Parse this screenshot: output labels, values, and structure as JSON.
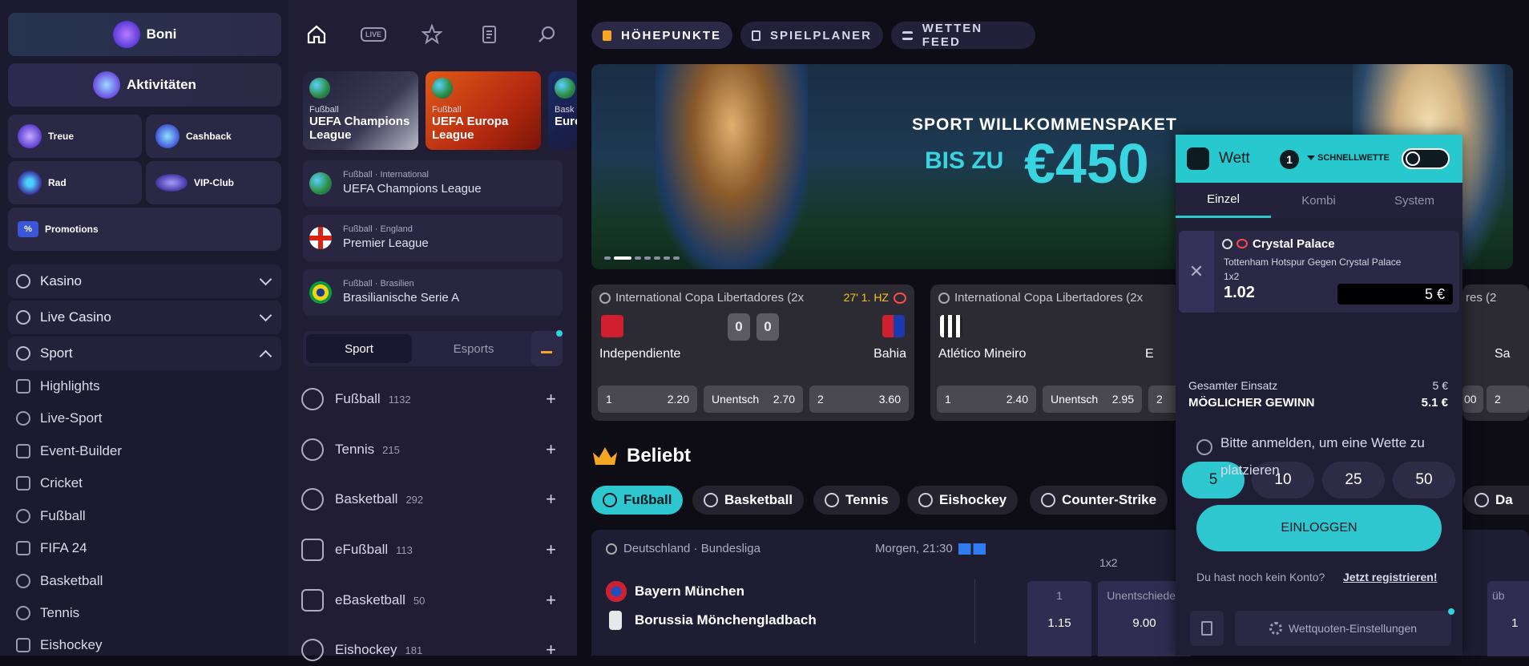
{
  "left": {
    "boni": "Boni",
    "aktivitaeten": "Aktivitäten",
    "tiles": [
      {
        "label": "Treue"
      },
      {
        "label": "Cashback"
      },
      {
        "label": "Rad"
      },
      {
        "label": "VIP-Club"
      },
      {
        "label": "Promotions"
      }
    ],
    "nav": [
      {
        "label": "Kasino"
      },
      {
        "label": "Live Casino"
      },
      {
        "label": "Sport"
      }
    ],
    "sport_items": [
      "Highlights",
      "Live-Sport",
      "Event-Builder",
      "Cricket",
      "Fußball",
      "FIFA 24",
      "Basketball",
      "Tennis",
      "Eishockey"
    ]
  },
  "mid": {
    "leagues": [
      {
        "cat": "Fußball",
        "name": "UEFA Champions League"
      },
      {
        "cat": "Fußball",
        "name": "UEFA Europa League"
      },
      {
        "cat": "Bask",
        "name": "Euro"
      }
    ],
    "rows": [
      {
        "cat": "Fußball · International",
        "name": "UEFA Champions League"
      },
      {
        "cat": "Fußball · England",
        "name": "Premier League"
      },
      {
        "cat": "Fußball · Brasilien",
        "name": "Brasilianische Serie A"
      }
    ],
    "toggle": {
      "sport": "Sport",
      "esports": "Esports"
    },
    "sports": [
      {
        "name": "Fußball",
        "count": "1132"
      },
      {
        "name": "Tennis",
        "count": "215"
      },
      {
        "name": "Basketball",
        "count": "292"
      },
      {
        "name": "eFußball",
        "count": "113"
      },
      {
        "name": "eBasketball",
        "count": "50"
      },
      {
        "name": "Eishockey",
        "count": "181"
      }
    ],
    "live_label": "LIVE"
  },
  "main": {
    "tabs": [
      "HÖHEPUNKTE",
      "SPIELPLANER",
      "WETTEN FEED"
    ],
    "banner": {
      "line1": "SPORT WILLKOMMENSPAKET",
      "line2a": "BIS ZU",
      "line2b": "€450"
    },
    "matches": [
      {
        "league": "International Copa Libertadores (2x",
        "time": "27' 1. HZ",
        "home": "Independiente",
        "away": "Bahia",
        "score_h": "0",
        "score_a": "0",
        "odds": [
          {
            "l": "1",
            "v": "2.20"
          },
          {
            "l": "Unentsch",
            "v": "2.70"
          },
          {
            "l": "2",
            "v": "3.60"
          }
        ]
      },
      {
        "league": "International Copa Libertadores (2x",
        "home": "Atlético Mineiro",
        "away": "E",
        "odds": [
          {
            "l": "1",
            "v": "2.40"
          },
          {
            "l": "Unentsch",
            "v": "2.95"
          },
          {
            "l": "2",
            "v": ""
          }
        ]
      },
      {
        "league": "res (2",
        "away": "Sa",
        "odds": [
          {
            "l": "",
            "v": "00"
          },
          {
            "l": "2",
            "v": ""
          }
        ]
      }
    ],
    "beliebt": "Beliebt",
    "cats": [
      "Fußball",
      "Basketball",
      "Tennis",
      "Eishockey",
      "Counter-Strike",
      "Da"
    ],
    "event": {
      "league": "Deutschland · Bundesliga",
      "time": "Morgen, 21:30",
      "market": "1x2",
      "home": "Bayern München",
      "away": "Borussia Mönchengladbach",
      "odds": [
        {
          "l": "1",
          "v": "1.15"
        },
        {
          "l": "Unentschieden",
          "v": "9.00"
        }
      ],
      "extra": "üb",
      "extra_v": "1"
    }
  },
  "slip": {
    "title": "Wett",
    "count": "1",
    "quick": "SCHNELLWETTE",
    "tabs": [
      "Einzel",
      "Kombi",
      "System"
    ],
    "bet": {
      "team": "Crystal Palace",
      "match": "Tottenham Hotspur Gegen Crystal Palace",
      "market": "1x2",
      "odd": "1.02",
      "stake": "5 €"
    },
    "quick_stakes": [
      "5",
      "10",
      "25",
      "50"
    ],
    "total_label": "Gesamter Einsatz",
    "total": "5 €",
    "win_label": "MÖGLICHER GEWINN",
    "win": "5.1 €",
    "login_msg": "Bitte anmelden, um eine Wette zu platzieren",
    "login_btn": "EINLOGGEN",
    "no_account": "Du hast noch kein Konto?",
    "register": "Jetzt registrieren!",
    "settings": "Wettquoten-Einstellungen"
  }
}
